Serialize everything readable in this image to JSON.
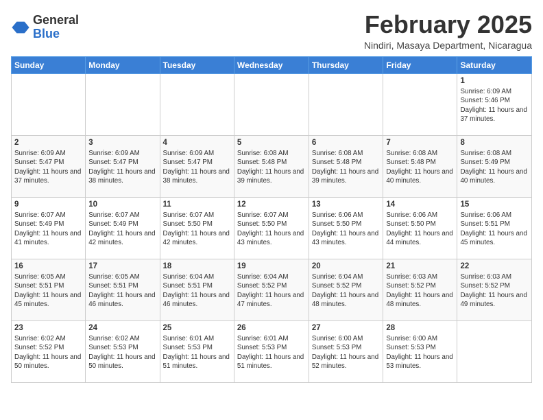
{
  "header": {
    "logo_general": "General",
    "logo_blue": "Blue",
    "month_title": "February 2025",
    "location": "Nindiri, Masaya Department, Nicaragua"
  },
  "days_of_week": [
    "Sunday",
    "Monday",
    "Tuesday",
    "Wednesday",
    "Thursday",
    "Friday",
    "Saturday"
  ],
  "weeks": [
    [
      {
        "day": "",
        "info": ""
      },
      {
        "day": "",
        "info": ""
      },
      {
        "day": "",
        "info": ""
      },
      {
        "day": "",
        "info": ""
      },
      {
        "day": "",
        "info": ""
      },
      {
        "day": "",
        "info": ""
      },
      {
        "day": "1",
        "info": "Sunrise: 6:09 AM\nSunset: 5:46 PM\nDaylight: 11 hours and 37 minutes."
      }
    ],
    [
      {
        "day": "2",
        "info": "Sunrise: 6:09 AM\nSunset: 5:47 PM\nDaylight: 11 hours and 37 minutes."
      },
      {
        "day": "3",
        "info": "Sunrise: 6:09 AM\nSunset: 5:47 PM\nDaylight: 11 hours and 38 minutes."
      },
      {
        "day": "4",
        "info": "Sunrise: 6:09 AM\nSunset: 5:47 PM\nDaylight: 11 hours and 38 minutes."
      },
      {
        "day": "5",
        "info": "Sunrise: 6:08 AM\nSunset: 5:48 PM\nDaylight: 11 hours and 39 minutes."
      },
      {
        "day": "6",
        "info": "Sunrise: 6:08 AM\nSunset: 5:48 PM\nDaylight: 11 hours and 39 minutes."
      },
      {
        "day": "7",
        "info": "Sunrise: 6:08 AM\nSunset: 5:48 PM\nDaylight: 11 hours and 40 minutes."
      },
      {
        "day": "8",
        "info": "Sunrise: 6:08 AM\nSunset: 5:49 PM\nDaylight: 11 hours and 40 minutes."
      }
    ],
    [
      {
        "day": "9",
        "info": "Sunrise: 6:07 AM\nSunset: 5:49 PM\nDaylight: 11 hours and 41 minutes."
      },
      {
        "day": "10",
        "info": "Sunrise: 6:07 AM\nSunset: 5:49 PM\nDaylight: 11 hours and 42 minutes."
      },
      {
        "day": "11",
        "info": "Sunrise: 6:07 AM\nSunset: 5:50 PM\nDaylight: 11 hours and 42 minutes."
      },
      {
        "day": "12",
        "info": "Sunrise: 6:07 AM\nSunset: 5:50 PM\nDaylight: 11 hours and 43 minutes."
      },
      {
        "day": "13",
        "info": "Sunrise: 6:06 AM\nSunset: 5:50 PM\nDaylight: 11 hours and 43 minutes."
      },
      {
        "day": "14",
        "info": "Sunrise: 6:06 AM\nSunset: 5:50 PM\nDaylight: 11 hours and 44 minutes."
      },
      {
        "day": "15",
        "info": "Sunrise: 6:06 AM\nSunset: 5:51 PM\nDaylight: 11 hours and 45 minutes."
      }
    ],
    [
      {
        "day": "16",
        "info": "Sunrise: 6:05 AM\nSunset: 5:51 PM\nDaylight: 11 hours and 45 minutes."
      },
      {
        "day": "17",
        "info": "Sunrise: 6:05 AM\nSunset: 5:51 PM\nDaylight: 11 hours and 46 minutes."
      },
      {
        "day": "18",
        "info": "Sunrise: 6:04 AM\nSunset: 5:51 PM\nDaylight: 11 hours and 46 minutes."
      },
      {
        "day": "19",
        "info": "Sunrise: 6:04 AM\nSunset: 5:52 PM\nDaylight: 11 hours and 47 minutes."
      },
      {
        "day": "20",
        "info": "Sunrise: 6:04 AM\nSunset: 5:52 PM\nDaylight: 11 hours and 48 minutes."
      },
      {
        "day": "21",
        "info": "Sunrise: 6:03 AM\nSunset: 5:52 PM\nDaylight: 11 hours and 48 minutes."
      },
      {
        "day": "22",
        "info": "Sunrise: 6:03 AM\nSunset: 5:52 PM\nDaylight: 11 hours and 49 minutes."
      }
    ],
    [
      {
        "day": "23",
        "info": "Sunrise: 6:02 AM\nSunset: 5:52 PM\nDaylight: 11 hours and 50 minutes."
      },
      {
        "day": "24",
        "info": "Sunrise: 6:02 AM\nSunset: 5:53 PM\nDaylight: 11 hours and 50 minutes."
      },
      {
        "day": "25",
        "info": "Sunrise: 6:01 AM\nSunset: 5:53 PM\nDaylight: 11 hours and 51 minutes."
      },
      {
        "day": "26",
        "info": "Sunrise: 6:01 AM\nSunset: 5:53 PM\nDaylight: 11 hours and 51 minutes."
      },
      {
        "day": "27",
        "info": "Sunrise: 6:00 AM\nSunset: 5:53 PM\nDaylight: 11 hours and 52 minutes."
      },
      {
        "day": "28",
        "info": "Sunrise: 6:00 AM\nSunset: 5:53 PM\nDaylight: 11 hours and 53 minutes."
      },
      {
        "day": "",
        "info": ""
      }
    ]
  ]
}
